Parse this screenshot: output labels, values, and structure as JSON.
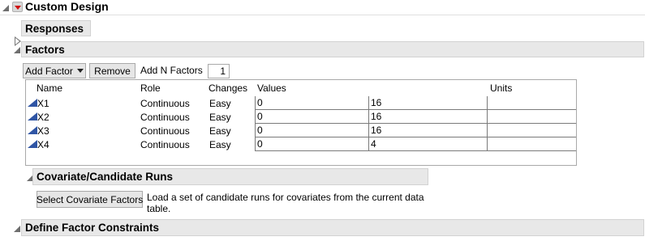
{
  "title": "Custom Design",
  "outlines": {
    "responses": "Responses",
    "factors": "Factors",
    "covariate": "Covariate/Candidate Runs",
    "constraints": "Define Factor Constraints"
  },
  "toolbar": {
    "add_factor": "Add Factor",
    "remove": "Remove",
    "add_n_label": "Add N Factors",
    "add_n_value": "1"
  },
  "table": {
    "headers": {
      "name": "Name",
      "role": "Role",
      "changes": "Changes",
      "values": "Values",
      "units": "Units"
    },
    "rows": [
      {
        "name": "X1",
        "role": "Continuous",
        "changes": "Easy",
        "low": "0",
        "high": "16",
        "units": ""
      },
      {
        "name": "X2",
        "role": "Continuous",
        "changes": "Easy",
        "low": "0",
        "high": "16",
        "units": ""
      },
      {
        "name": "X3",
        "role": "Continuous",
        "changes": "Easy",
        "low": "0",
        "high": "16",
        "units": ""
      },
      {
        "name": "X4",
        "role": "Continuous",
        "changes": "Easy",
        "low": "0",
        "high": "4",
        "units": ""
      }
    ]
  },
  "covariate": {
    "button": "Select Covariate Factors",
    "description_line1": "Load a set of candidate runs for covariates from the current data",
    "description_line2": "table."
  }
}
